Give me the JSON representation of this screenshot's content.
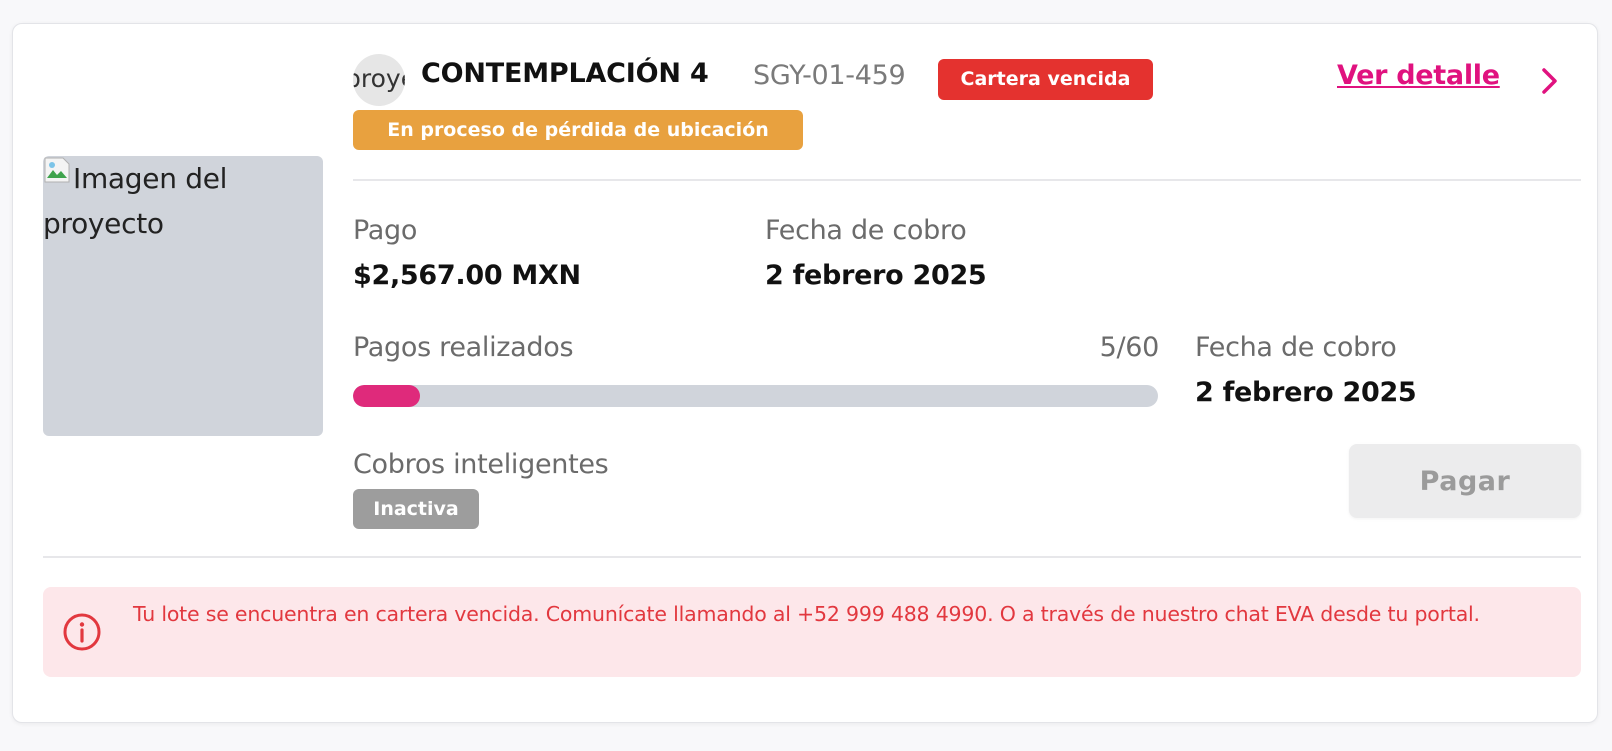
{
  "project": {
    "image_alt": "Imagen del proyecto",
    "logo_text": "proyecto",
    "name": "CONTEMPLACIÓN 4",
    "code": "SGY-01-459",
    "status_badge": "Cartera vencida",
    "warning_badge": "En proceso de pérdida de ubicación",
    "detail_link": "Ver detalle"
  },
  "payment": {
    "amount_label": "Pago",
    "amount_value": "$2,567.00 MXN",
    "date_label": "Fecha de cobro",
    "date_value": "2 febrero 2025"
  },
  "progress": {
    "label": "Pagos realizados",
    "count_text": "5/60",
    "completed": 5,
    "total": 60,
    "date_label": "Fecha de cobro",
    "date_value": "2 febrero 2025"
  },
  "smart_billing": {
    "label": "Cobros inteligentes",
    "status": "Inactiva"
  },
  "actions": {
    "pay_label": "Pagar"
  },
  "alert": {
    "message": "Tu lote se encuentra en cartera vencida. Comunícate llamando al +52 999 488 4990. O a través de nuestro chat EVA desde tu portal."
  },
  "colors": {
    "accent": "#e0127f",
    "danger": "#e4322f",
    "warning": "#e8a13f",
    "progress_fill": "#df2a7b",
    "alert_background": "#fde7ea",
    "alert_text": "#e2383f"
  },
  "icons": {
    "detail_arrow": "chevron-right-icon",
    "alert": "info-circle-icon",
    "image_placeholder": "broken-image-icon"
  }
}
